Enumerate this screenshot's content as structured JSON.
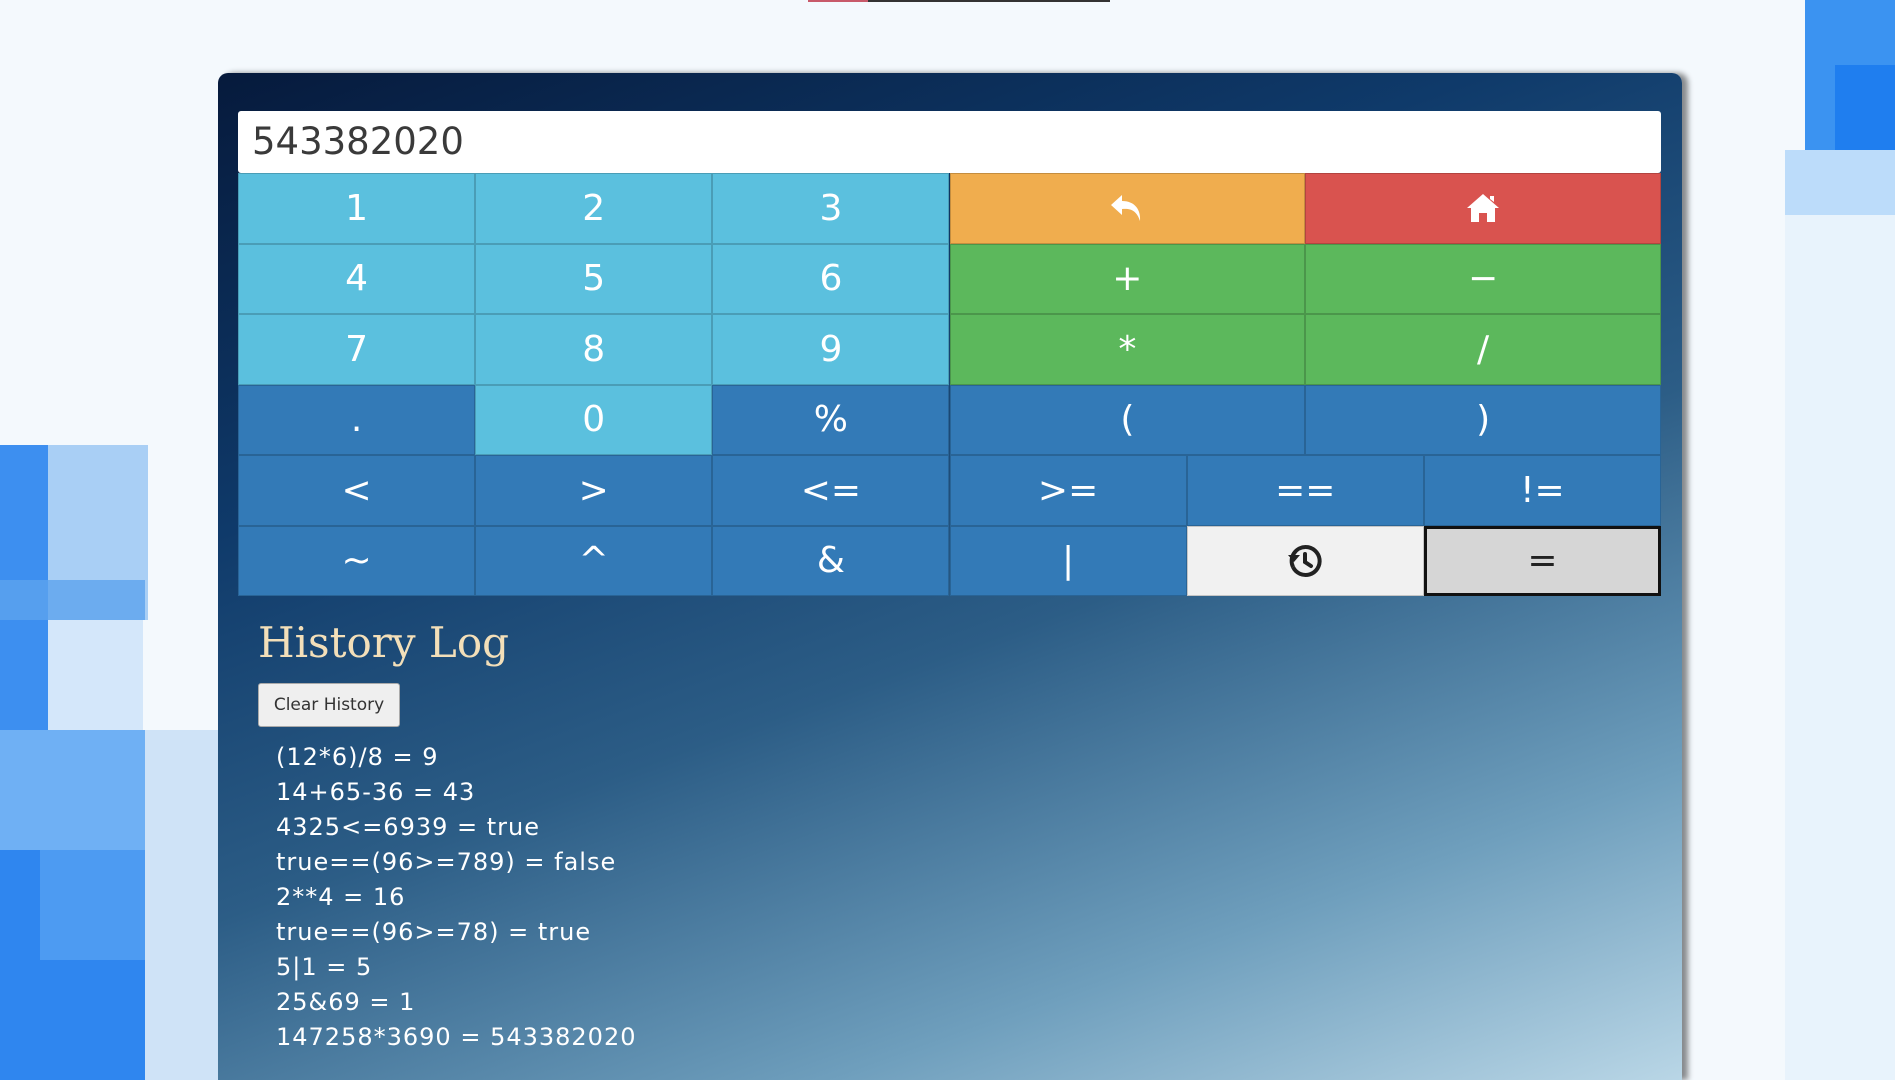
{
  "display": {
    "value": "543382020"
  },
  "keypad": {
    "rows": [
      [
        {
          "label": "1",
          "style": "num",
          "name": "key-1"
        },
        {
          "label": "2",
          "style": "num",
          "name": "key-2"
        },
        {
          "label": "3",
          "style": "num",
          "name": "key-3"
        },
        {
          "label": "",
          "icon": "undo-icon",
          "style": "warn",
          "name": "backspace-button"
        },
        {
          "label": "",
          "icon": "home-icon",
          "style": "danger",
          "name": "home-button"
        }
      ],
      [
        {
          "label": "4",
          "style": "num",
          "name": "key-4"
        },
        {
          "label": "5",
          "style": "num",
          "name": "key-5"
        },
        {
          "label": "6",
          "style": "num",
          "name": "key-6"
        },
        {
          "label": "+",
          "style": "op",
          "name": "key-plus"
        },
        {
          "label": "−",
          "style": "op",
          "name": "key-minus"
        }
      ],
      [
        {
          "label": "7",
          "style": "num",
          "name": "key-7"
        },
        {
          "label": "8",
          "style": "num",
          "name": "key-8"
        },
        {
          "label": "9",
          "style": "num",
          "name": "key-9"
        },
        {
          "label": "*",
          "style": "op",
          "name": "key-multiply"
        },
        {
          "label": "/",
          "style": "op",
          "name": "key-divide"
        }
      ],
      [
        {
          "label": ".",
          "style": "blue",
          "name": "key-decimal"
        },
        {
          "label": "0",
          "style": "num",
          "name": "key-0"
        },
        {
          "label": "%",
          "style": "blue",
          "name": "key-modulo"
        },
        {
          "label": "(",
          "style": "blue",
          "name": "key-open-paren"
        },
        {
          "label": ")",
          "style": "blue",
          "name": "key-close-paren"
        }
      ],
      [
        {
          "label": "<",
          "style": "blue",
          "name": "key-less-than"
        },
        {
          "label": ">",
          "style": "blue",
          "name": "key-greater-than"
        },
        {
          "label": "<=",
          "style": "blue",
          "name": "key-less-equal"
        },
        {
          "label": ">=",
          "style": "blue",
          "name": "key-greater-equal"
        },
        {
          "label": "==",
          "style": "blue",
          "name": "key-equal-equal"
        },
        {
          "label": "!=",
          "style": "blue",
          "name": "key-not-equal"
        }
      ],
      [
        {
          "label": "~",
          "style": "blue",
          "name": "key-bitwise-not"
        },
        {
          "label": "^",
          "style": "blue",
          "name": "key-xor"
        },
        {
          "label": "&",
          "style": "blue",
          "name": "key-and"
        },
        {
          "label": "|",
          "style": "blue",
          "name": "key-or"
        },
        {
          "label": "",
          "icon": "history-icon",
          "style": "light",
          "name": "history-button"
        },
        {
          "label": "=",
          "style": "eq",
          "name": "equals-button"
        }
      ]
    ]
  },
  "history": {
    "title": "History Log",
    "clear_label": "Clear History",
    "entries": [
      "(12*6)/8 = 9",
      "14+65-36 = 43",
      "4325<=6939 = true",
      "true==(96>=789) = false",
      "2**4 = 16",
      "true==(96>=78) = true",
      "5|1 = 5",
      "25&69 = 1",
      "147258*3690 = 543382020"
    ]
  },
  "colors": {
    "number_key": "#5bc0de",
    "operator_key": "#5cb85c",
    "logic_key": "#337ab7",
    "backspace_key": "#f0ad4e",
    "home_key": "#d9534f",
    "history_title": "#f3dfb9"
  }
}
